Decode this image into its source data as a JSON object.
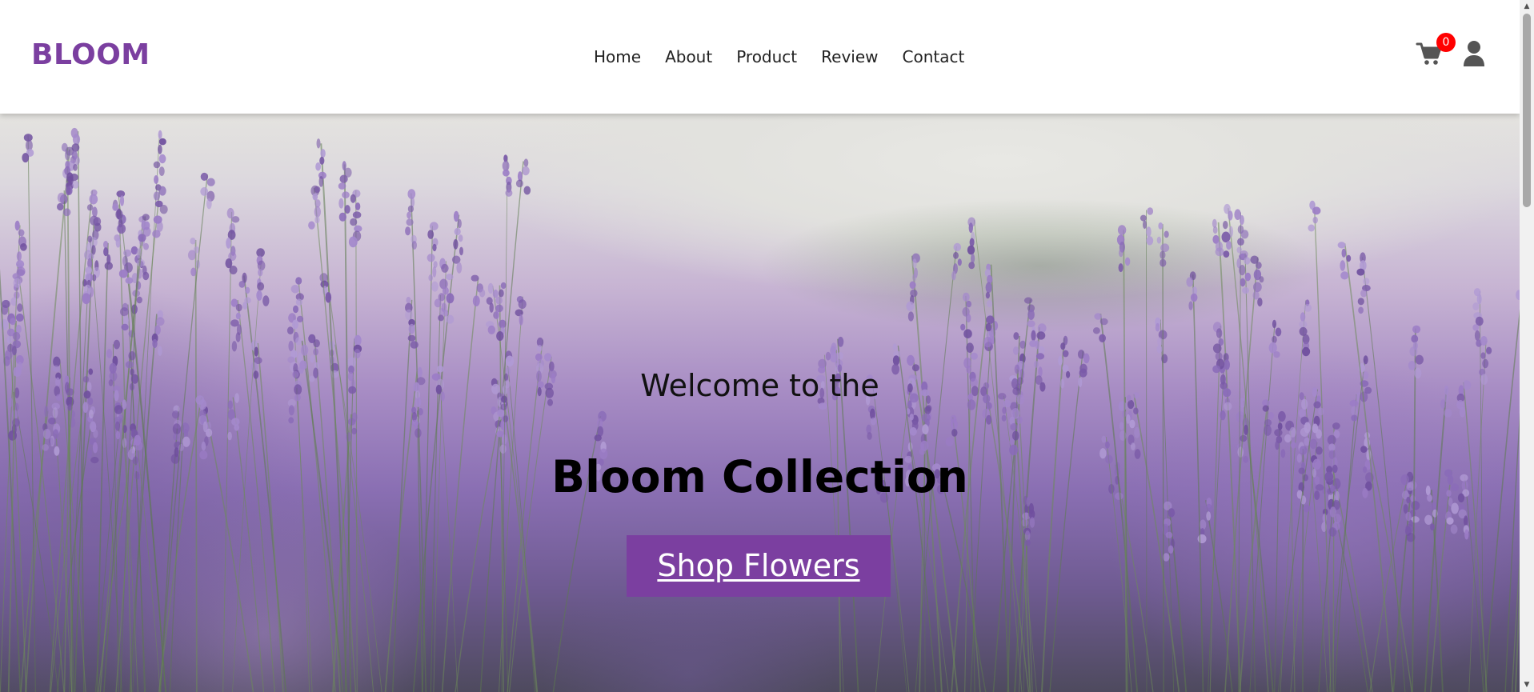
{
  "header": {
    "logo": "BLOOM",
    "nav": [
      "Home",
      "About",
      "Product",
      "Review",
      "Contact"
    ],
    "cart": {
      "icon": "shopping-cart-icon",
      "count": "0"
    },
    "user_icon": "user-icon"
  },
  "hero": {
    "welcome": "Welcome to the",
    "title": "Bloom Collection",
    "cta_label": "Shop Flowers",
    "background": "lavender-field-photo"
  },
  "colors": {
    "brand": "#7b3fa0",
    "badge": "#ff0000",
    "nav_text": "#222222"
  },
  "scrollbar": {
    "up": "▲",
    "down": "▼"
  }
}
